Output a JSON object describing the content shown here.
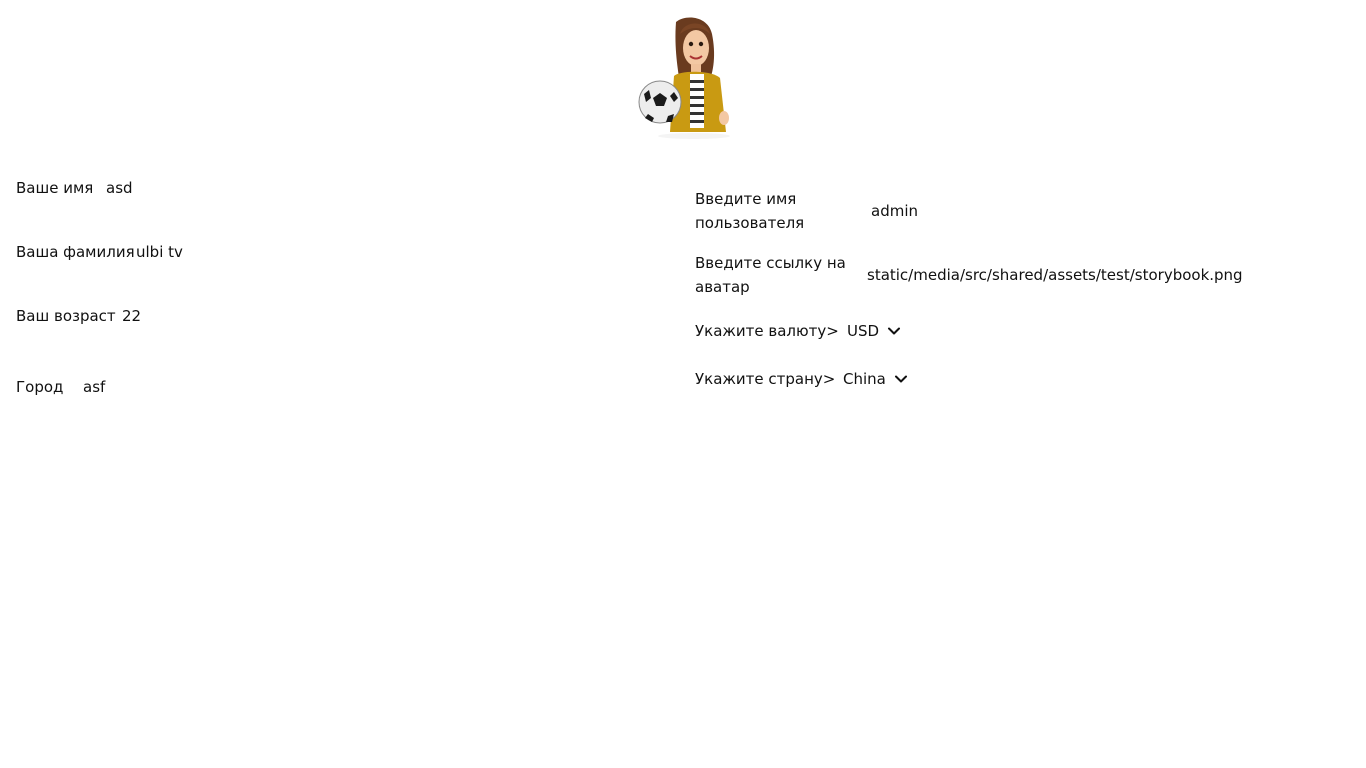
{
  "profile": {
    "avatar": {
      "icon": "avatar-cartoon-woman-with-soccer-ball-icon"
    },
    "left": {
      "first_name": {
        "label": "Ваше имя",
        "value": "asd"
      },
      "last_name": {
        "label": "Ваша фамилия",
        "value": "ulbi tv"
      },
      "age": {
        "label": "Ваш возраст",
        "value": "22"
      },
      "city": {
        "label": "Город",
        "value": "asf"
      }
    },
    "right": {
      "username": {
        "label": "Введите имя пользователя",
        "value": "admin"
      },
      "avatar_link": {
        "label": "Введите ссылку на аватар",
        "value": "static/media/src/shared/assets/test/storybook.png"
      },
      "currency": {
        "label": "Укажите валюту>",
        "value": "USD",
        "icon": "chevron-down-icon"
      },
      "country": {
        "label": "Укажите страну>",
        "value": "China",
        "icon": "chevron-down-icon"
      }
    }
  }
}
